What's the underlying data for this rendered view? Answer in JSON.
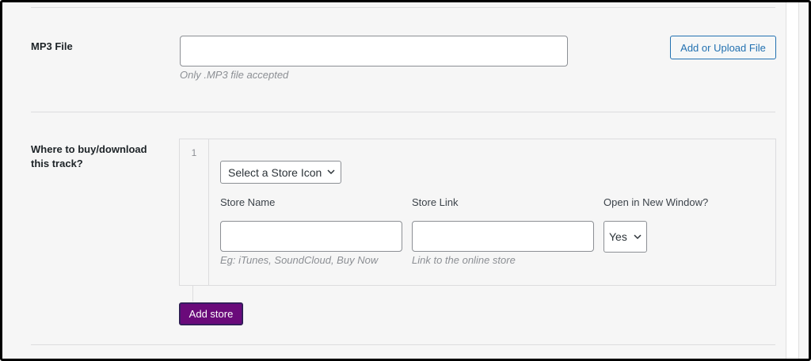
{
  "mp3": {
    "label": "MP3 File",
    "input_value": "",
    "hint": "Only .MP3 file accepted",
    "upload_button": "Add or Upload File"
  },
  "store": {
    "label": "Where to buy/download this track?",
    "row_number": "1",
    "icon_select": "Select a Store Icon",
    "columns": {
      "store_name": "Store Name",
      "store_link": "Store Link",
      "new_window": "Open in New Window?"
    },
    "store_name_value": "",
    "store_link_value": "",
    "store_name_hint": "Eg: iTunes, SoundCloud, Buy Now",
    "store_link_hint": "Link to the online store",
    "new_window_value": "Yes",
    "add_button": "Add store"
  },
  "colors": {
    "accent_blue": "#2271b1",
    "add_store_bg": "#6a0a7a"
  },
  "icons": [
    "chevron-down-icon"
  ]
}
